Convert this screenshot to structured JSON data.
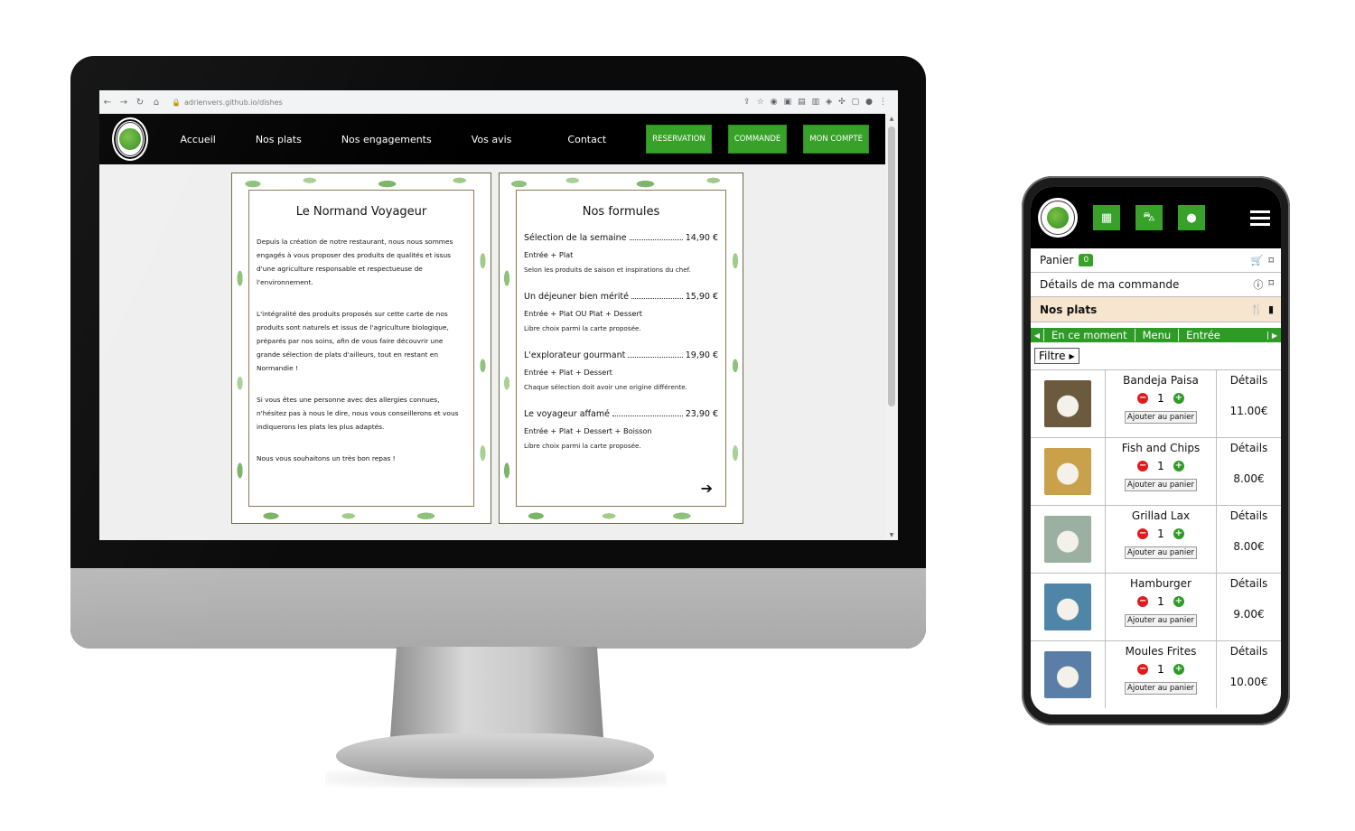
{
  "desktop": {
    "browser": {
      "url": "adrienvers.github.io/dishes"
    },
    "header": {
      "nav": [
        "Accueil",
        "Nos plats",
        "Nos engagements",
        "Vos avis",
        "Contact"
      ],
      "buttons": [
        "RESERVATION",
        "COMMANDE",
        "MON COMPTE"
      ]
    },
    "about_card": {
      "title": "Le Normand Voyageur",
      "paragraphs": [
        "Depuis la création de notre restaurant, nous nous sommes engagés à vous proposer des produits de qualités et issus d'une agriculture responsable et respectueuse de l'environnement.",
        "L'intégralité des produits proposés sur cette carte de nos produits sont naturels et issus de l'agriculture biologique, préparés par nos soins, afin de vous faire découvrir une grande sélection de plats d'ailleurs, tout en restant en Normandie !",
        "Si vous êtes une personne avec des allergies connues, n'hésitez pas à nous le dire, nous vous conseillerons et vous indiquerons les plats les plus adaptés.",
        "Nous vous souhaitons un très bon repas !"
      ]
    },
    "formulas_card": {
      "title": "Nos formules",
      "items": [
        {
          "name": "Sélection de la semaine",
          "price": "14,90 €",
          "contents": "Entrée + Plat",
          "note": "Selon les produits de saison et inspirations du chef."
        },
        {
          "name": "Un déjeuner bien mérité",
          "price": "15,90 €",
          "contents": "Entrée + Plat OU Plat + Dessert",
          "note": "Libre choix parmi la carte proposée."
        },
        {
          "name": "L'explorateur gourmant",
          "price": "19,90 €",
          "contents": "Entrée + Plat + Dessert",
          "note": "Chaque sélection doit avoir une origine différente."
        },
        {
          "name": "Le voyageur affamé",
          "price": "23,90 €",
          "contents": "Entrée + Plat + Dessert + Boisson",
          "note": "Libre choix parmi la carte proposée."
        }
      ]
    }
  },
  "mobile": {
    "rows": {
      "cart_label": "Panier",
      "cart_count": "0",
      "order_details": "Détails de ma commande",
      "our_dishes": "Nos plats"
    },
    "categories": [
      "En ce moment",
      "Menu",
      "Entrée"
    ],
    "filter_label": "Filtre",
    "add_label": "Ajouter au panier",
    "details_label": "Détails",
    "dishes": [
      {
        "name": "Bandeja Paisa",
        "qty": "1",
        "price": "11.00€",
        "color": "#6b5a3e"
      },
      {
        "name": "Fish and Chips",
        "qty": "1",
        "price": "8.00€",
        "color": "#c9a14a"
      },
      {
        "name": "Grillad Lax",
        "qty": "1",
        "price": "8.00€",
        "color": "#9bb0a0"
      },
      {
        "name": "Hamburger",
        "qty": "1",
        "price": "9.00€",
        "color": "#4f86a8"
      },
      {
        "name": "Moules Frites",
        "qty": "1",
        "price": "10.00€",
        "color": "#5a7fa6"
      }
    ]
  }
}
